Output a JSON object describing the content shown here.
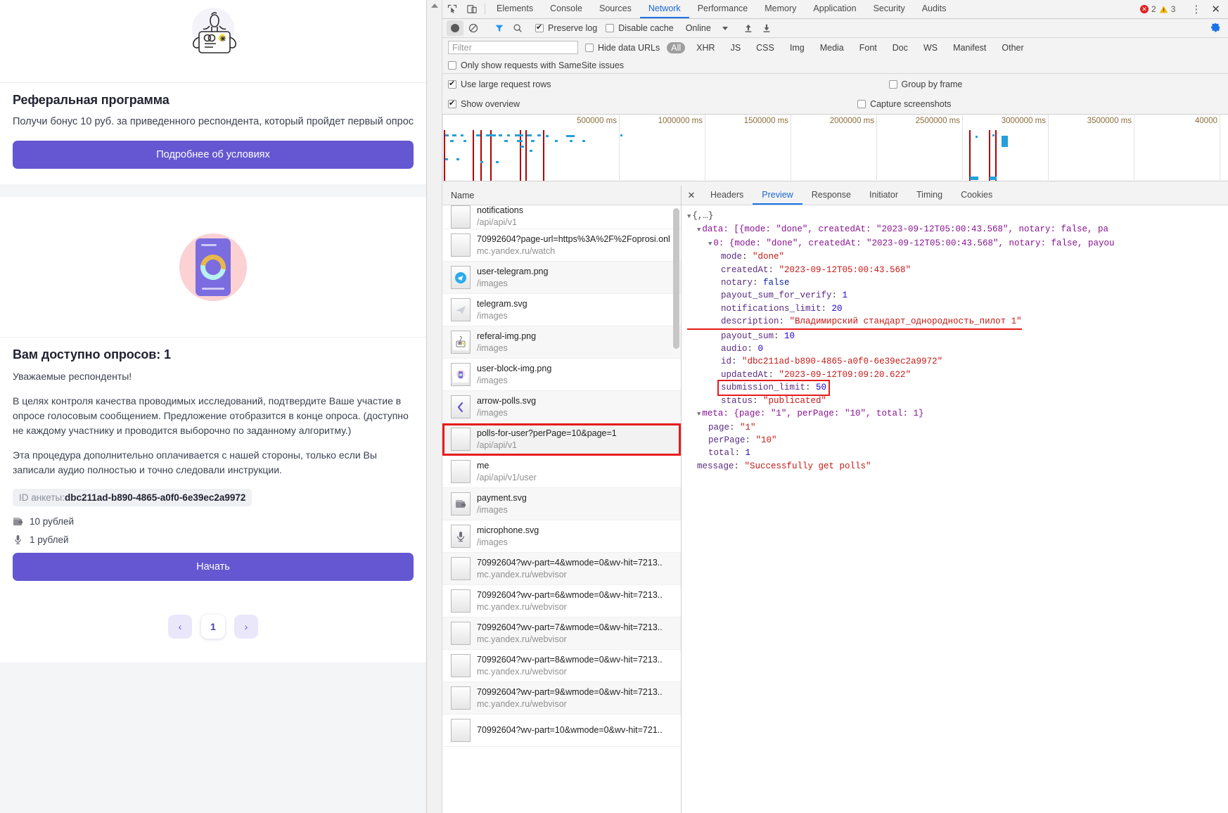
{
  "webpage": {
    "referral_card": {
      "illustration": "man-holding-card-illustration",
      "title": "Реферальная программа",
      "text": "Получи бонус 10 руб. за приведенного респондента, который пройдет первый опрос",
      "button": "Подробнее об условиях"
    },
    "polls_card": {
      "illustration": "phone-donut-chart-illustration",
      "title": "Вам доступно опросов: 1",
      "greeting": "Уважаемые респонденты!",
      "paragraph1": "В целях контроля качества проводимых исследований, подтвердите Ваше участие в опросе голосовым сообщением. Предложение отобразится в конце опроса. (доступно не каждому участнику и проводится выборочно по заданному алгоритму.)",
      "paragraph2": "Эта процедура дополнительно оплачивается с нашей стороны, только если Вы записали аудио полностью и точно следовали инструкции.",
      "id_label": "ID анкеты:",
      "id_value": "dbc211ad-b890-4865-a0f0-6e39ec2a9972",
      "payout": "10 рублей",
      "audio_payout": "1 рублей",
      "start_button": "Начать"
    },
    "pagination": {
      "prev": "‹",
      "current": "1",
      "next": "›"
    }
  },
  "devtools": {
    "panels": [
      "Elements",
      "Console",
      "Sources",
      "Network",
      "Performance",
      "Memory",
      "Application",
      "Security",
      "Audits"
    ],
    "active_panel": "Network",
    "errors": "2",
    "warnings": "3",
    "toolbar": {
      "preserve_log": "Preserve log",
      "preserve_log_checked": true,
      "disable_cache": "Disable cache",
      "disable_cache_checked": false,
      "throttle": "Online"
    },
    "filter": {
      "placeholder": "Filter",
      "value": "",
      "hide_data_urls": "Hide data URLs",
      "hide_data_urls_checked": false,
      "types": [
        "All",
        "XHR",
        "JS",
        "CSS",
        "Img",
        "Media",
        "Font",
        "Doc",
        "WS",
        "Manifest",
        "Other"
      ],
      "active_type": "All",
      "samesite": "Only show requests with SameSite issues",
      "samesite_checked": false,
      "large_rows": "Use large request rows",
      "large_rows_checked": true,
      "group_by_frame": "Group by frame",
      "group_by_frame_checked": false,
      "show_overview": "Show overview",
      "show_overview_checked": true,
      "capture_screenshots": "Capture screenshots",
      "capture_screenshots_checked": false
    },
    "overview_ticks": [
      "500000 ms",
      "1000000 ms",
      "1500000 ms",
      "2000000 ms",
      "2500000 ms",
      "3000000 ms",
      "3500000 ms",
      "40000"
    ],
    "requests_header": "Name",
    "requests": [
      {
        "name": "notifications",
        "sub": "/api/api/v1",
        "icon": "blank-doc-icon",
        "selected": false,
        "clipped_top": true
      },
      {
        "name": "70992604?page-url=https%3A%2F%2Foprosi.onl",
        "sub": "mc.yandex.ru/watch",
        "icon": "blank-doc-icon",
        "selected": false
      },
      {
        "name": "user-telegram.png",
        "sub": "/images",
        "icon": "telegram-avatar-icon",
        "selected": false
      },
      {
        "name": "telegram.svg",
        "sub": "/images",
        "icon": "telegram-plane-icon",
        "selected": false
      },
      {
        "name": "referal-img.png",
        "sub": "/images",
        "icon": "referral-thumb-icon",
        "selected": false
      },
      {
        "name": "user-block-img.png",
        "sub": "/images",
        "icon": "user-block-thumb-icon",
        "selected": false
      },
      {
        "name": "arrow-polls.svg",
        "sub": "/images",
        "icon": "arrow-left-icon",
        "selected": false
      },
      {
        "name": "polls-for-user?perPage=10&page=1",
        "sub": "/api/api/v1",
        "icon": "blank-doc-icon",
        "selected": true
      },
      {
        "name": "me",
        "sub": "/api/api/v1/user",
        "icon": "blank-doc-icon",
        "selected": false
      },
      {
        "name": "payment.svg",
        "sub": "/images",
        "icon": "wallet-icon",
        "selected": false
      },
      {
        "name": "microphone.svg",
        "sub": "/images",
        "icon": "microphone-icon",
        "selected": false
      },
      {
        "name": "70992604?wv-part=4&wmode=0&wv-hit=7213..",
        "sub": "mc.yandex.ru/webvisor",
        "icon": "blank-doc-icon",
        "selected": false
      },
      {
        "name": "70992604?wv-part=6&wmode=0&wv-hit=7213..",
        "sub": "mc.yandex.ru/webvisor",
        "icon": "blank-doc-icon",
        "selected": false
      },
      {
        "name": "70992604?wv-part=7&wmode=0&wv-hit=7213..",
        "sub": "mc.yandex.ru/webvisor",
        "icon": "blank-doc-icon",
        "selected": false
      },
      {
        "name": "70992604?wv-part=8&wmode=0&wv-hit=7213..",
        "sub": "mc.yandex.ru/webvisor",
        "icon": "blank-doc-icon",
        "selected": false
      },
      {
        "name": "70992604?wv-part=9&wmode=0&wv-hit=7213..",
        "sub": "mc.yandex.ru/webvisor",
        "icon": "blank-doc-icon",
        "selected": false
      },
      {
        "name": "70992604?wv-part=10&wmode=0&wv-hit=721..",
        "sub": "",
        "icon": "blank-doc-icon",
        "selected": false
      }
    ],
    "detail_tabs": [
      "Headers",
      "Preview",
      "Response",
      "Initiator",
      "Timing",
      "Cookies"
    ],
    "active_detail_tab": "Preview",
    "preview": {
      "root": "{,…}",
      "data_summary": "data: [{mode: \"done\", createdAt: \"2023-09-12T05:00:43.568\", notary: false, pa",
      "item0_summary": "0: {mode: \"done\", createdAt: \"2023-09-12T05:00:43.568\", notary: false, payou",
      "fields": [
        {
          "key": "mode",
          "value": "\"done\"",
          "type": "string"
        },
        {
          "key": "createdAt",
          "value": "\"2023-09-12T05:00:43.568\"",
          "type": "string"
        },
        {
          "key": "notary",
          "value": "false",
          "type": "bool"
        },
        {
          "key": "payout_sum_for_verify",
          "value": "1",
          "type": "number"
        },
        {
          "key": "notifications_limit",
          "value": "20",
          "type": "number"
        },
        {
          "key": "description",
          "value": "\"Владимирский стандарт_однородность_пилот 1\"",
          "type": "string",
          "highlight": "underline"
        },
        {
          "key": "payout_sum",
          "value": "10",
          "type": "number"
        },
        {
          "key": "audio",
          "value": "0",
          "type": "number"
        },
        {
          "key": "id",
          "value": "\"dbc211ad-b890-4865-a0f0-6e39ec2a9972\"",
          "type": "string"
        },
        {
          "key": "updatedAt",
          "value": "\"2023-09-12T09:09:20.622\"",
          "type": "string"
        },
        {
          "key": "submission_limit",
          "value": "50",
          "type": "number",
          "highlight": "box"
        },
        {
          "key": "status",
          "value": "\"publicated\"",
          "type": "string"
        }
      ],
      "meta_summary": "meta: {page: \"1\", perPage: \"10\", total: 1}",
      "meta_fields": [
        {
          "key": "page",
          "value": "\"1\"",
          "type": "string"
        },
        {
          "key": "perPage",
          "value": "\"10\"",
          "type": "string"
        },
        {
          "key": "total",
          "value": "1",
          "type": "number"
        }
      ],
      "message": {
        "key": "message",
        "value": "\"Successfully get polls\"",
        "type": "string"
      }
    }
  }
}
